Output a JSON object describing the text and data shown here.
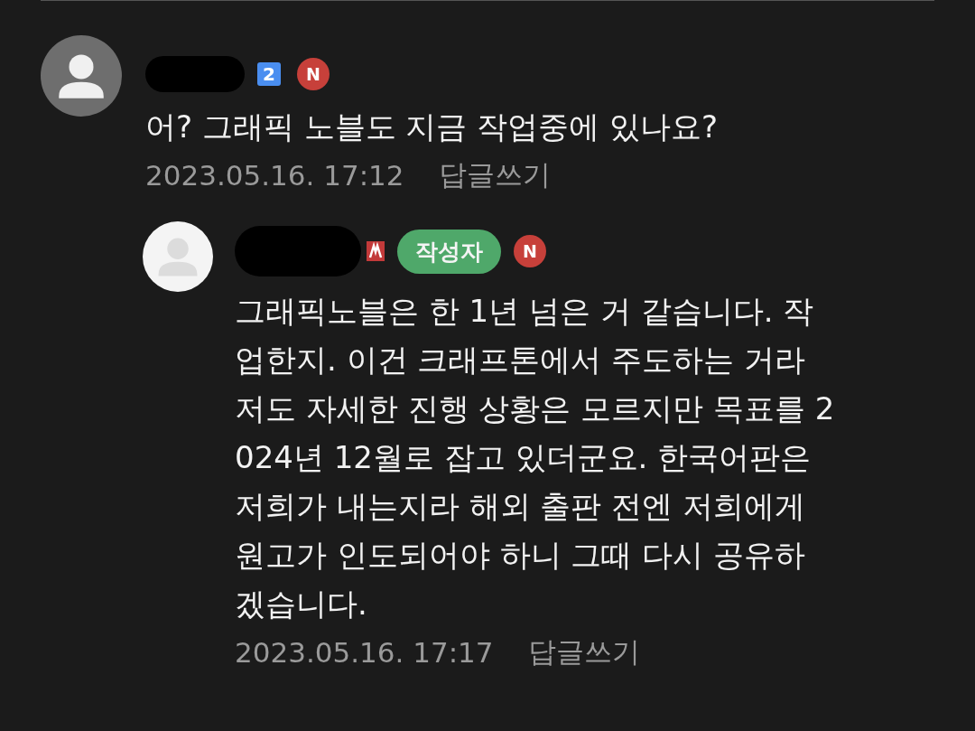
{
  "comments": [
    {
      "kind": "comment",
      "badges": [
        {
          "kind": "level",
          "text": "2"
        },
        {
          "kind": "new",
          "text": "N"
        }
      ],
      "lines": [
        "어? 그래픽 노블도 지금 작업중에 있나요?"
      ],
      "date": "2023.05.16. 17:12",
      "reply_link": "답글쓰기"
    },
    {
      "kind": "reply",
      "badges": [
        {
          "kind": "level-icon"
        },
        {
          "kind": "writer",
          "text": "작성자"
        },
        {
          "kind": "new",
          "text": "N"
        }
      ],
      "lines": [
        "그래픽노블은 한 1년 넘은 거 같습니다. 작",
        "업한지. 이건 크래프톤에서 주도하는 거라",
        "저도 자세한 진행 상황은 모르지만 목표를 2",
        "024년 12월로 잡고 있더군요. 한국어판은",
        "저희가 내는지라 해외 출판 전엔 저희에게",
        "원고가 인도되어야 하니 그때 다시 공유하",
        "겠습니다."
      ],
      "date": "2023.05.16. 17:17",
      "reply_link": "답글쓰기"
    }
  ]
}
